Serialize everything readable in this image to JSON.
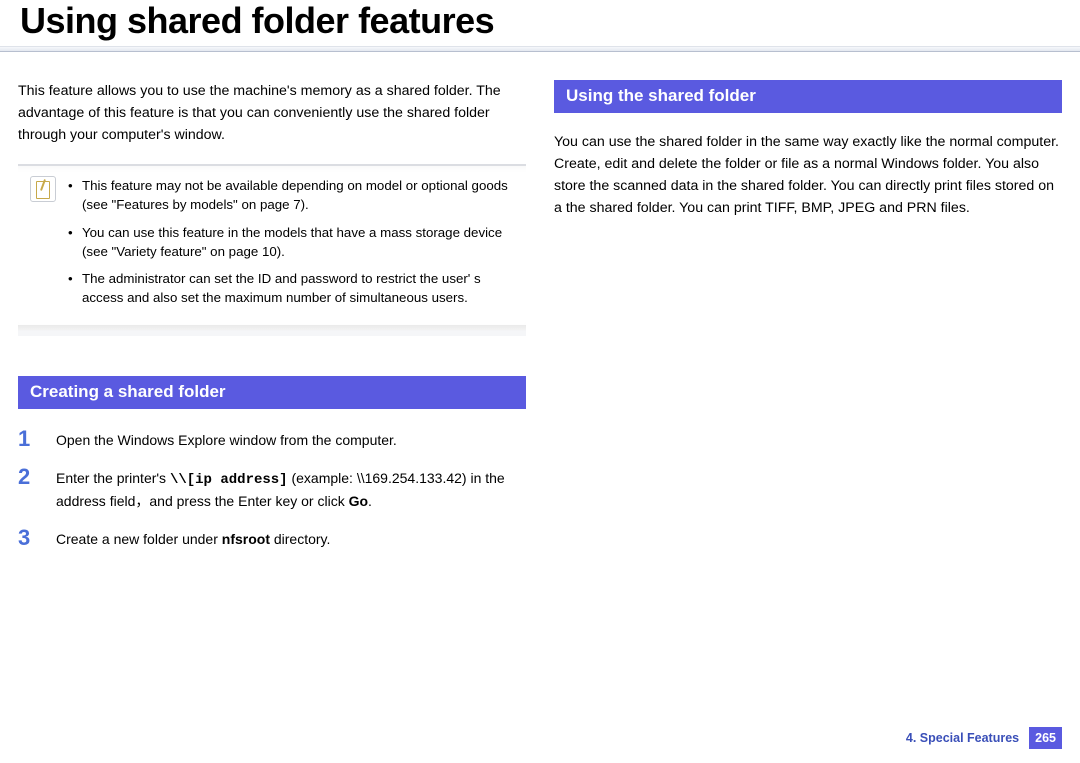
{
  "title": "Using shared folder features",
  "intro_paragraph": "This feature allows you to use the machine's memory as a shared folder. The advantage of this feature is that you can conveniently use the shared folder through your computer's window.",
  "note": {
    "items": [
      "This feature may not be available depending on model or optional goods (see \"Features by models\" on page 7).",
      "You can use this feature in the models that have a mass storage device (see \"Variety feature\" on page 10).",
      "The administrator can set the ID and password to restrict the user' s access and also set the maximum number of simultaneous users."
    ]
  },
  "section_left_heading": "Creating a shared folder",
  "steps": [
    {
      "num": "1",
      "html": "Open the Windows Explore window from the computer."
    },
    {
      "num": "2",
      "html": "Enter the printer's <span class='mono'>\\\\[ip address]</span> (example: \\\\169.254.133.42) in the address field，and press the Enter key or click <b>Go</b>."
    },
    {
      "num": "3",
      "html": "Create a new folder under <b>nfsroot</b> directory."
    }
  ],
  "section_right_heading": "Using the shared folder",
  "right_paragraph": "You can use the shared folder in the same way exactly like the normal computer. Create, edit and delete the folder or file as a normal Windows folder. You also store the scanned data in the shared folder. You can directly print files stored on a the shared folder. You can print TIFF, BMP, JPEG and PRN files.",
  "footer": {
    "chapter": "4.  Special Features",
    "page": "265"
  }
}
